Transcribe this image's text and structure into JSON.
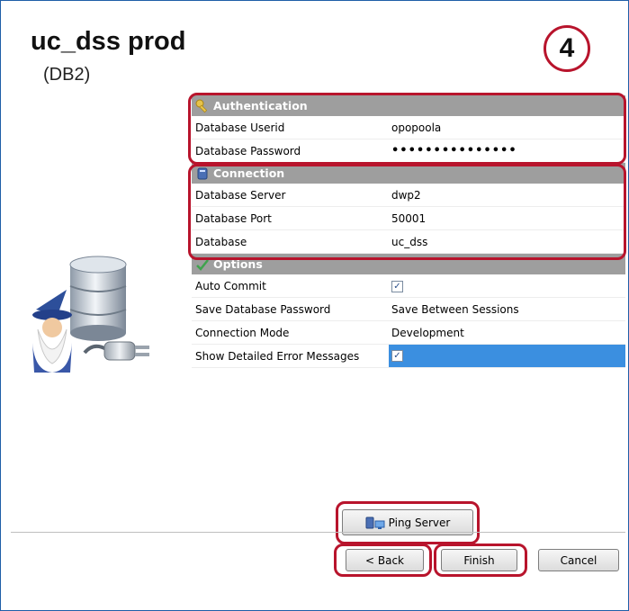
{
  "header": {
    "title": "uc_dss prod",
    "subtitle": "(DB2)",
    "step": "4"
  },
  "sections": {
    "authentication": {
      "title": "Authentication",
      "icon": "key-icon",
      "rows": [
        {
          "label": "Database Userid",
          "value": "opopoola"
        },
        {
          "label": "Database Password",
          "value": "•••••••••••••••"
        }
      ]
    },
    "connection": {
      "title": "Connection",
      "icon": "database-icon",
      "rows": [
        {
          "label": "Database Server",
          "value": "dwp2"
        },
        {
          "label": "Database Port",
          "value": "50001"
        },
        {
          "label": "Database",
          "value": "uc_dss"
        }
      ]
    },
    "options": {
      "title": "Options",
      "icon": "checkmark-icon",
      "rows": [
        {
          "label": "Auto Commit",
          "value": "checked"
        },
        {
          "label": "Save Database Password",
          "value": "Save Between Sessions"
        },
        {
          "label": "Connection Mode",
          "value": "Development"
        },
        {
          "label": "Show Detailed Error Messages",
          "value": "checked"
        }
      ]
    }
  },
  "buttons": {
    "ping": "Ping Server",
    "back": "< Back",
    "finish": "Finish",
    "cancel": "Cancel"
  },
  "colors": {
    "highlight": "#b8142c",
    "section_bg": "#9e9e9e",
    "selection": "#3b8fe0"
  }
}
